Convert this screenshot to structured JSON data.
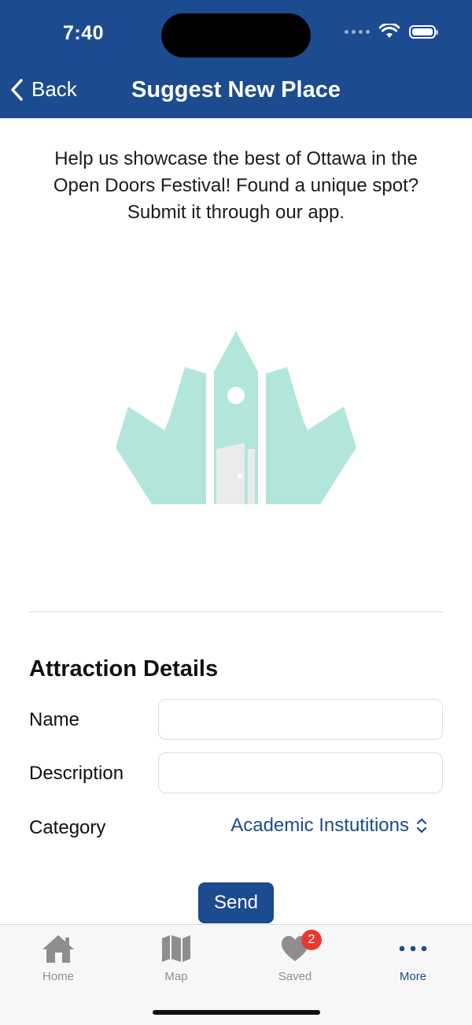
{
  "status_bar": {
    "time": "7:40"
  },
  "nav": {
    "back_label": "Back",
    "title": "Suggest New Place"
  },
  "intro": {
    "text": "Help us showcase the best of Ottawa in the Open Doors Festival! Found a unique spot? Submit it through our app."
  },
  "form": {
    "section_title": "Attraction Details",
    "name_label": "Name",
    "name_value": "",
    "description_label": "Description",
    "description_value": "",
    "category_label": "Category",
    "category_value": "Academic Instutitions",
    "send_label": "Send"
  },
  "tabs": [
    {
      "label": "Home",
      "icon": "home-icon"
    },
    {
      "label": "Map",
      "icon": "map-icon"
    },
    {
      "label": "Saved",
      "icon": "heart-icon",
      "badge": "2"
    },
    {
      "label": "More",
      "icon": "more-icon",
      "active": true
    }
  ],
  "colors": {
    "brand": "#1d4b8f",
    "logo": "#b2e6dc",
    "badge": "#e9392f"
  }
}
